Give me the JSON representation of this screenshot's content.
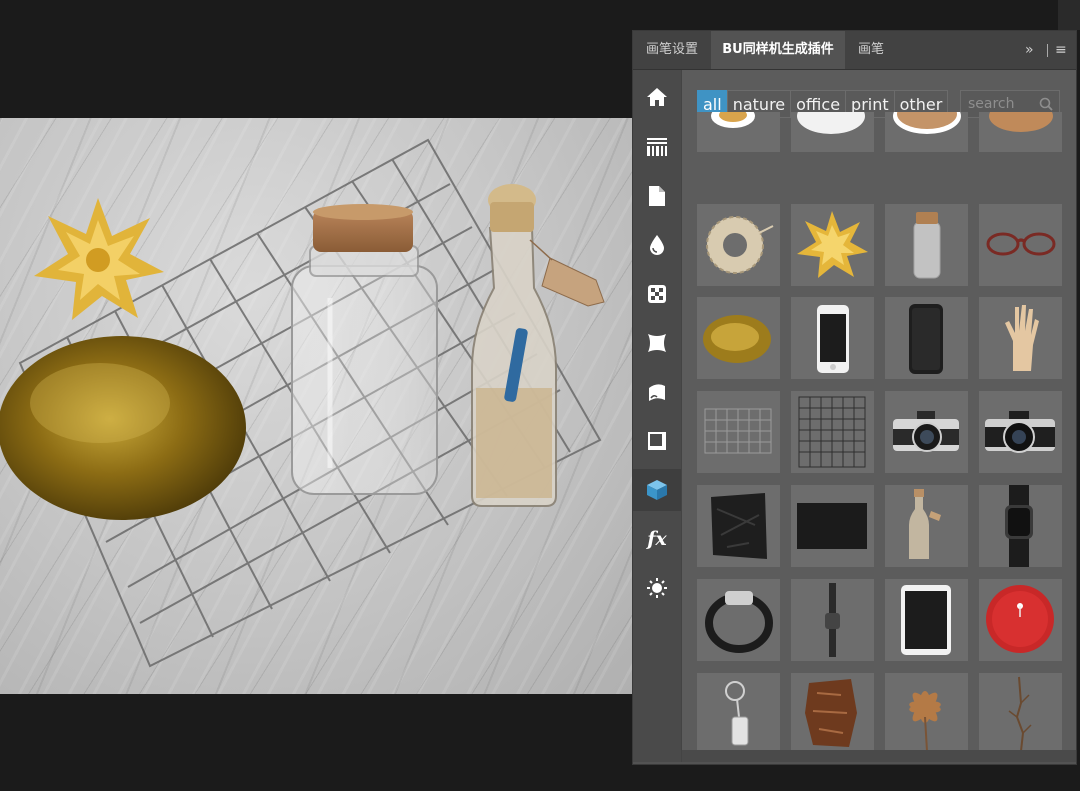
{
  "panel": {
    "tabs": [
      {
        "label": "画笔设置",
        "active": false
      },
      {
        "label": "BU同样机生成插件",
        "active": true
      },
      {
        "label": "画笔",
        "active": false
      }
    ],
    "expand_glyph": "»",
    "menu_glyph": "≡"
  },
  "sidebar": {
    "tools": [
      {
        "name": "home-icon",
        "selected": false
      },
      {
        "name": "texture-icon",
        "selected": false
      },
      {
        "name": "document-icon",
        "selected": false
      },
      {
        "name": "drop-icon",
        "selected": false
      },
      {
        "name": "checkerboard-icon",
        "selected": false
      },
      {
        "name": "warp-icon",
        "selected": false
      },
      {
        "name": "curl-icon",
        "selected": false
      },
      {
        "name": "frame-icon",
        "selected": false
      },
      {
        "name": "cube-icon",
        "selected": true
      },
      {
        "name": "fx-icon",
        "selected": false
      },
      {
        "name": "light-icon",
        "selected": false
      }
    ],
    "fx_label": "fx"
  },
  "filters": [
    {
      "label": "all",
      "active": true
    },
    {
      "label": "nature",
      "active": false
    },
    {
      "label": "office",
      "active": false
    },
    {
      "label": "print",
      "active": false
    },
    {
      "label": "other",
      "active": false
    }
  ],
  "search": {
    "placeholder": "search",
    "icon": "search-icon"
  },
  "assets": [
    [
      "coffee-cup",
      "white-plate",
      "cork-coaster",
      "cork-board"
    ],
    [
      "twine-ball",
      "gold-bow",
      "glass-jar",
      "glasses"
    ],
    [
      "gold-dish",
      "phone-white",
      "phone-black",
      "wooden-hand"
    ],
    [
      "wire-grid",
      "wire-grid-tall",
      "camera-silver",
      "camera-black"
    ],
    [
      "crumpled-fabric",
      "black-slate",
      "message-bottle",
      "smartwatch"
    ],
    [
      "smartwatch-band",
      "watch-side",
      "tablet",
      "red-candle"
    ],
    [
      "keychain",
      "tree-bark",
      "dried-flower",
      "dried-twig"
    ]
  ],
  "colors": {
    "accent": "#3f93c4",
    "panel_bg": "#535353",
    "thumb_bg": "#6d6d6d",
    "cube": "#4aa6d8"
  }
}
